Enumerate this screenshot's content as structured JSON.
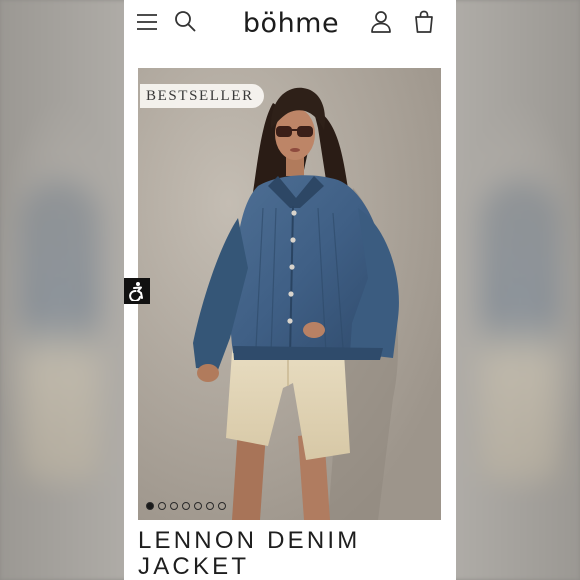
{
  "header": {
    "brand": "böhme",
    "icons": {
      "menu": "hamburger-menu-icon",
      "search": "search-icon",
      "account": "account-icon",
      "cart": "shopping-bag-icon"
    }
  },
  "product": {
    "badge": "BESTSELLER",
    "title_line1": "LENNON DENIM",
    "title_line2": "JACKET",
    "gallery": {
      "total_images": 7,
      "active_index": 0
    }
  },
  "accessibility": {
    "icon": "accessibility-icon"
  },
  "colors": {
    "background": "#ffffff",
    "text": "#1e1e1e",
    "badge_bg": "#f7f4f0",
    "denim": "#3f5f85",
    "shorts": "#e3d6b6",
    "accessibility_btn": "#111111"
  }
}
